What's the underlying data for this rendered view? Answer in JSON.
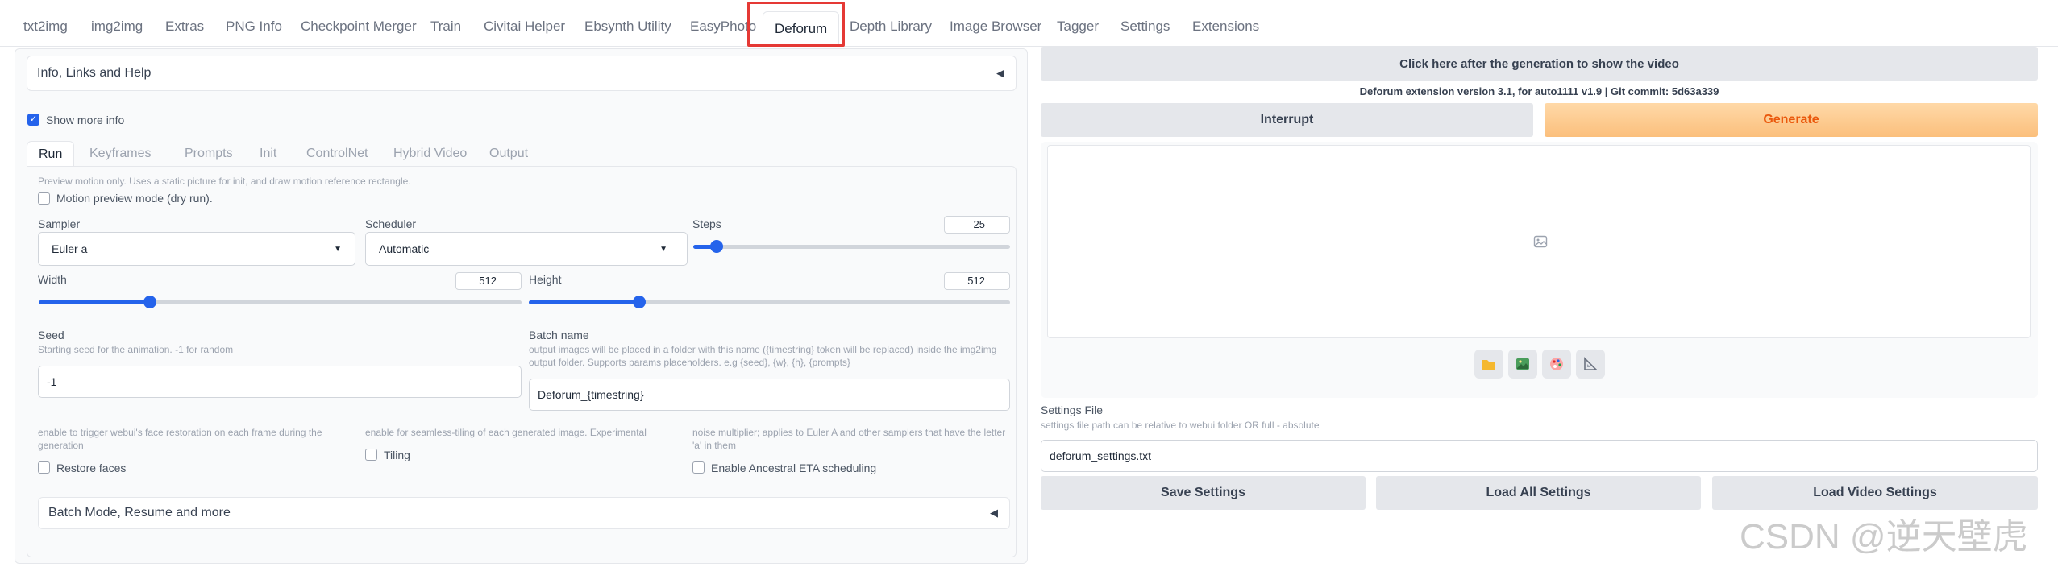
{
  "top_tabs": [
    "txt2img",
    "img2img",
    "Extras",
    "PNG Info",
    "Checkpoint Merger",
    "Train",
    "Civitai Helper",
    "Ebsynth Utility",
    "EasyPhoto",
    "Deforum",
    "Depth Library",
    "Image Browser",
    "Tagger",
    "Settings",
    "Extensions"
  ],
  "active_top_tab": "Deforum",
  "left": {
    "info_accordion": "Info, Links and Help",
    "show_more_info": "Show more info",
    "sub_tabs": [
      "Run",
      "Keyframes",
      "Prompts",
      "Init",
      "ControlNet",
      "Hybrid Video",
      "Output"
    ],
    "preview_note": "Preview motion only. Uses a static picture for init, and draw motion reference rectangle.",
    "motion_preview": "Motion preview mode (dry run).",
    "sampler": {
      "label": "Sampler",
      "value": "Euler a"
    },
    "scheduler": {
      "label": "Scheduler",
      "value": "Automatic"
    },
    "steps": {
      "label": "Steps",
      "value": "25",
      "fraction": 0.075
    },
    "width": {
      "label": "Width",
      "value": "512",
      "fraction": 0.23
    },
    "height": {
      "label": "Height",
      "value": "512",
      "fraction": 0.23
    },
    "seed": {
      "label": "Seed",
      "desc": "Starting seed for the animation. -1 for random",
      "value": "-1"
    },
    "batch_name": {
      "label": "Batch name",
      "desc": "output images will be placed in a folder with this name ({timestring} token will be replaced) inside the img2img output folder. Supports params placeholders. e.g {seed}, {w}, {h}, {prompts}",
      "value": "Deforum_{timestring}"
    },
    "restore_faces": {
      "desc": "enable to trigger webui's face restoration on each frame during the generation",
      "label": "Restore faces"
    },
    "tiling": {
      "desc": "enable for seamless-tiling of each generated image. Experimental",
      "label": "Tiling"
    },
    "ancestral": {
      "desc": "noise multiplier; applies to Euler A and other samplers that have the letter 'a' in them",
      "label": "Enable Ancestral ETA scheduling"
    },
    "batch_mode": "Batch Mode, Resume and more"
  },
  "right": {
    "show_video_button": "Click here after the generation to show the video",
    "version": "Deforum extension version 3.1, for auto1111 v1.9 | Git commit: 5d63a339",
    "interrupt": "Interrupt",
    "generate": "Generate",
    "settings_file": {
      "label": "Settings File",
      "desc": "settings file path can be relative to webui folder OR full - absolute",
      "value": "deforum_settings.txt"
    },
    "save_settings": "Save Settings",
    "load_all": "Load All Settings",
    "load_video": "Load Video Settings",
    "icons": [
      "folder-icon",
      "image-icon",
      "palette-icon",
      "ruler-icon"
    ]
  },
  "watermark": "CSDN @逆天壁虎",
  "colors": {
    "accent": "#2563eb",
    "generate_text": "#ea580c",
    "highlight": "#e53935"
  }
}
